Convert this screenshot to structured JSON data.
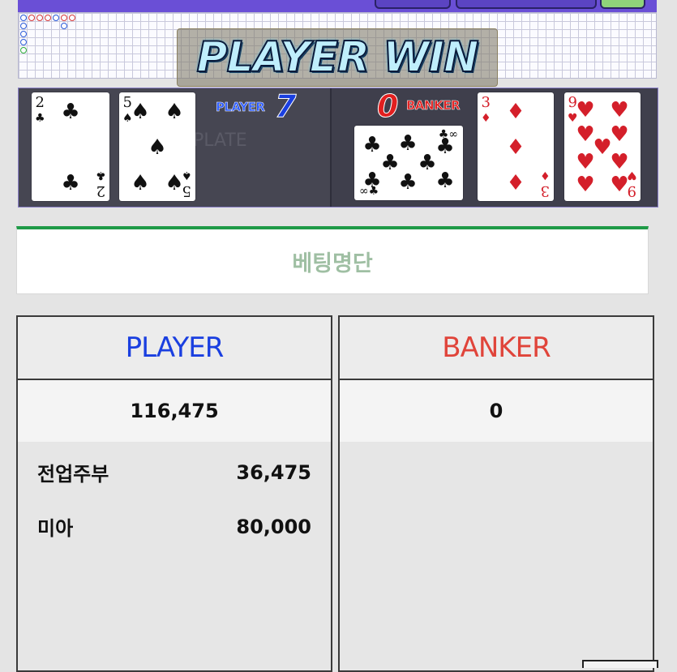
{
  "result": {
    "banner_text": "PLAYER WIN"
  },
  "table": {
    "player_label": "PLAYER",
    "player_score": "7",
    "banker_label": "BANKER",
    "banker_score": "0",
    "plate_text": "PLATE"
  },
  "player_cards": [
    {
      "rank": "2",
      "suit": "♣",
      "color": "black"
    },
    {
      "rank": "5",
      "suit": "♠",
      "color": "black"
    }
  ],
  "banker_cards": [
    {
      "rank": "8",
      "suit": "♣",
      "color": "black",
      "orientation": "sideways"
    },
    {
      "rank": "3",
      "suit": "♦",
      "color": "red"
    },
    {
      "rank": "9",
      "suit": "♥",
      "color": "red"
    }
  ],
  "betting_list": {
    "title": "베팅명단"
  },
  "columns": {
    "player": {
      "header": "PLAYER",
      "header_color": "#1a3fe0",
      "total": "116,475",
      "bettors": [
        {
          "name": "전업주부",
          "amount": "36,475"
        },
        {
          "name": "미아",
          "amount": "80,000"
        }
      ]
    },
    "banker": {
      "header": "BANKER",
      "header_color": "#e0443a",
      "total": "0",
      "bettors": []
    }
  },
  "colors": {
    "accent_green": "#1f9a47",
    "board_purple": "#6a4fd6",
    "player_blue": "#1a3fe0",
    "banker_red": "#e0443a"
  }
}
